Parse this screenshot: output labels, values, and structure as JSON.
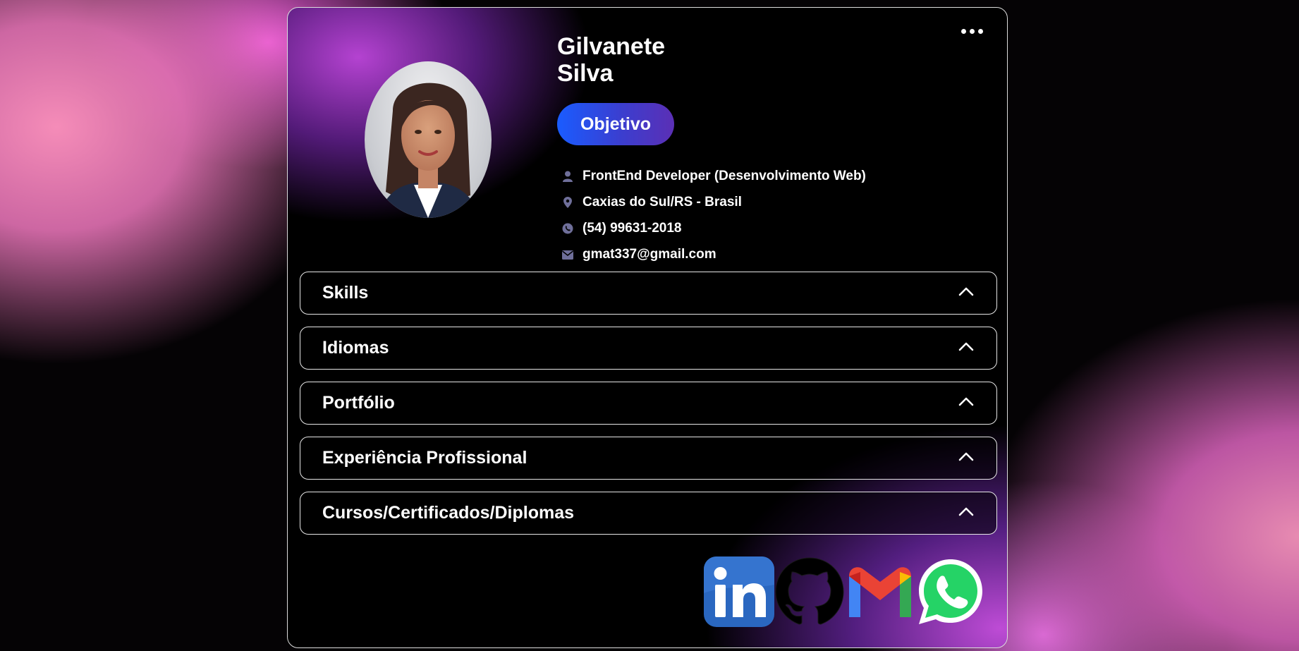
{
  "profile": {
    "first_name": "Gilvanete",
    "last_name": "Silva",
    "objective_label": "Objetivo",
    "role": "FrontEnd Developer (Desenvolvimento Web)",
    "location": "Caxias do Sul/RS - Brasil",
    "phone": "(54) 99631-2018",
    "email": "gmat337@gmail.com"
  },
  "sections": [
    {
      "label": "Skills"
    },
    {
      "label": "Idiomas"
    },
    {
      "label": "Portfólio"
    },
    {
      "label": "Experiência Profissional"
    },
    {
      "label": "Cursos/Certificados/Diplomas"
    }
  ],
  "social": [
    {
      "icon": "linkedin-icon"
    },
    {
      "icon": "github-icon"
    },
    {
      "icon": "gmail-icon"
    },
    {
      "icon": "whatsapp-icon"
    }
  ],
  "colors": {
    "accent_blue": "#1a5cff",
    "accent_purple": "#5b2fb5",
    "icon_muted": "#6f6f9a"
  }
}
